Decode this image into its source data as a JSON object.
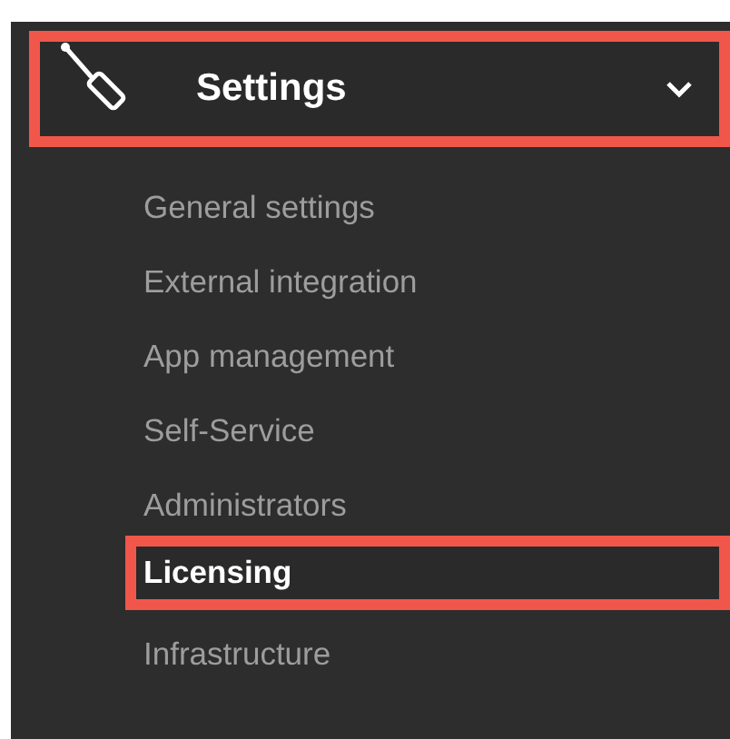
{
  "menu": {
    "title": "Settings",
    "expanded": true,
    "items": [
      {
        "label": "General settings",
        "selected": false
      },
      {
        "label": "External integration",
        "selected": false
      },
      {
        "label": "App management",
        "selected": false
      },
      {
        "label": "Self-Service",
        "selected": false
      },
      {
        "label": "Administrators",
        "selected": false
      },
      {
        "label": "Licensing",
        "selected": true
      },
      {
        "label": "Infrastructure",
        "selected": false
      }
    ]
  }
}
